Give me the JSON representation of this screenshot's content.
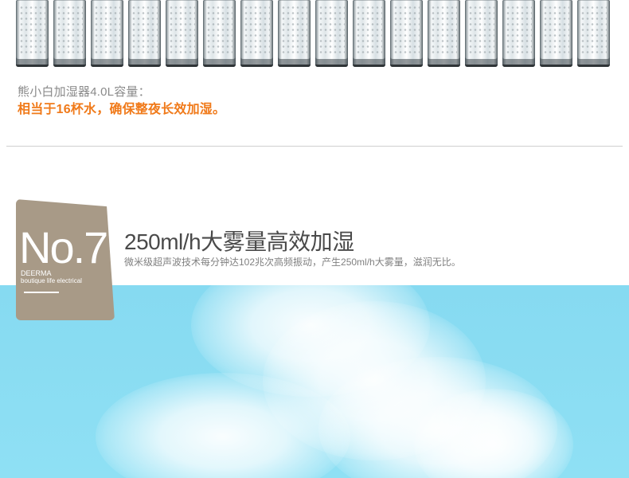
{
  "glasses": {
    "count": 16
  },
  "capacity": {
    "line1": "熊小白加湿器4.0L容量：",
    "line2": "相当于16杯水，确保整夜长效加湿。"
  },
  "feature": {
    "number": "No.7",
    "brand": "DEERMA",
    "brand_sub": "boutique life electrical",
    "title": "250ml/h大雾量高效加湿",
    "description": "微米级超声波技术每分钟达102兆次高频振动，产生250ml/h大雾量，滋润无比。"
  },
  "colors": {
    "accent": "#f07a1a",
    "badge": "#a89a87",
    "sky": "#86daf1"
  }
}
